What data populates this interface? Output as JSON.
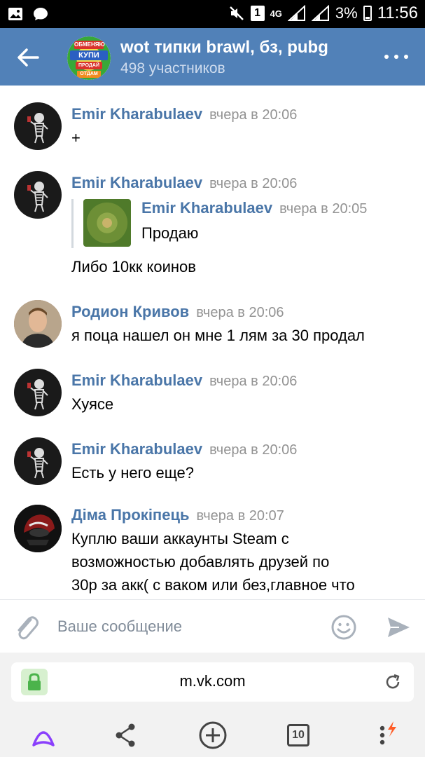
{
  "status_bar": {
    "sim_number": "1",
    "network": "4G",
    "battery": "3%",
    "time": "11:56"
  },
  "header": {
    "title": "wot типки brawl, бз, pubg",
    "subtitle": "498 участников",
    "avatar_text": {
      "top": "ОБМЕНЯЮ",
      "mid": "КУПИ",
      "low": "ПРОДАЙ",
      "bottom": "ОТДАМ"
    }
  },
  "messages": [
    {
      "author": "Emir Kharabulaev",
      "time": "вчера в 20:06",
      "lines": [
        "+"
      ]
    },
    {
      "author": "Emir Kharabulaev",
      "time": "вчера в 20:06",
      "forward": {
        "author": "Emir Kharabulaev",
        "time": "вчера в 20:05",
        "text": "Продаю"
      },
      "lines": [
        "Либо 10кк коинов"
      ]
    },
    {
      "author": "Родион Кривов",
      "time": "вчера в 20:06",
      "lines": [
        "я поца нашел он мне 1 лям за 30 продал"
      ]
    },
    {
      "author": "Emir Kharabulaev",
      "time": "вчера в 20:06",
      "lines": [
        "Хуясе"
      ]
    },
    {
      "author": "Emir Kharabulaev",
      "time": "вчера в 20:06",
      "lines": [
        "Есть у него еще?"
      ]
    },
    {
      "author": "Діма Прокіпець",
      "time": "вчера в 20:07",
      "lines": [
        "Куплю ваши аккаунты Steam с",
        "возможностью добавлять друзей по",
        "30р за акк( с ваком или без,главное что"
      ]
    }
  ],
  "composer": {
    "placeholder": "Ваше сообщение"
  },
  "browser": {
    "url": "m.vk.com",
    "tabs_count": "10"
  },
  "colors": {
    "header_bg": "#5181b8",
    "author_link": "#4a76a8",
    "timestamp": "#939393",
    "secure_lock": "#4bb34b",
    "alice_purple": "#8a3ffc",
    "notify_orange": "#ff5c26"
  },
  "icons": [
    "image-icon",
    "chat-bubble-icon",
    "mute-icon",
    "signal-icon",
    "back-arrow-icon",
    "more-icon",
    "paperclip-icon",
    "emoji-icon",
    "send-icon",
    "lock-icon",
    "reload-icon",
    "alice-icon",
    "share-icon",
    "add-icon",
    "tabs-icon",
    "menu-icon"
  ]
}
